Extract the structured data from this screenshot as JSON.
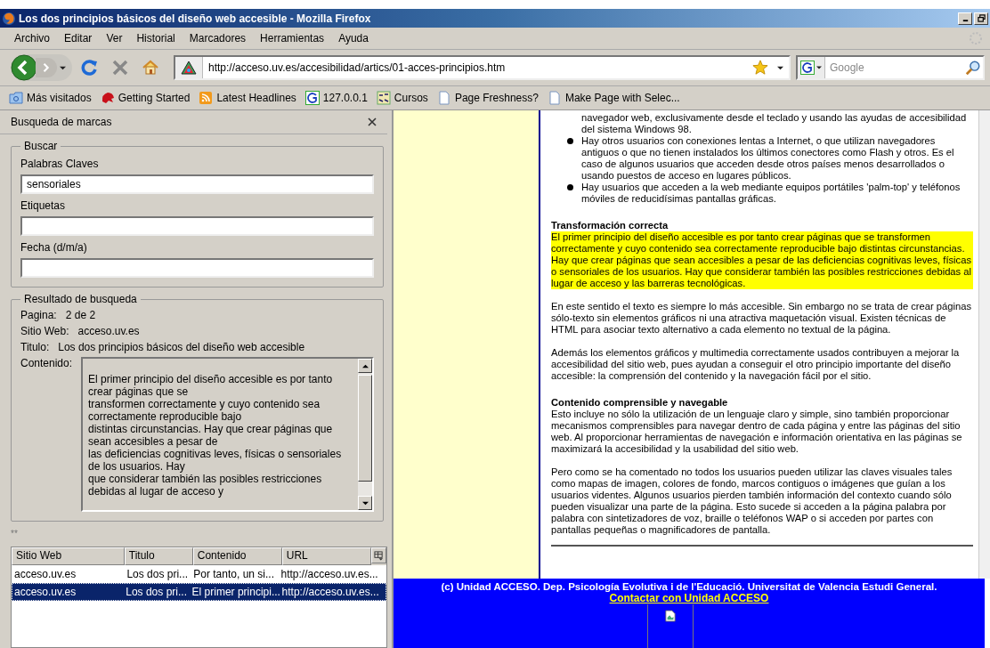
{
  "window": {
    "title": "Los dos principios básicos del diseño web accesible - Mozilla Firefox"
  },
  "menu": [
    {
      "label": "Archivo"
    },
    {
      "label": "Editar"
    },
    {
      "label": "Ver"
    },
    {
      "label": "Historial"
    },
    {
      "label": "Marcadores"
    },
    {
      "label": "Herramientas"
    },
    {
      "label": "Ayuda"
    }
  ],
  "toolbar": {
    "url": "http://acceso.uv.es/accesibilidad/artics/01-acces-principios.htm",
    "search_placeholder": "Google"
  },
  "bookmarks": [
    {
      "label": "Más visitados",
      "kind": "folder"
    },
    {
      "label": "Getting Started",
      "kind": "creature"
    },
    {
      "label": "Latest Headlines",
      "kind": "feed"
    },
    {
      "label": "127.0.0.1",
      "kind": "letter"
    },
    {
      "label": "Cursos",
      "kind": "badge"
    },
    {
      "label": "Page Freshness?",
      "kind": "page"
    },
    {
      "label": "Make Page with Selec...",
      "kind": "page"
    }
  ],
  "sidebar": {
    "title": "Busqueda de marcas",
    "search_group": {
      "legend": "Buscar",
      "fields": [
        {
          "label": "Palabras Claves",
          "value": "sensoriales"
        },
        {
          "label": "Etiquetas"
        },
        {
          "label": "Fecha (d/m/a)"
        }
      ]
    },
    "result_group": {
      "legend": "Resultado de busqueda",
      "details": [
        {
          "label": "Pagina:",
          "value": "2 de 2"
        },
        {
          "label": "Sitio Web:",
          "value": "acceso.uv.es"
        },
        {
          "label": "Titulo:",
          "value": "Los dos principios básicos del diseño web accesible"
        }
      ],
      "content_label": "Contenido:",
      "content_lines": [
        "El primer principio del diseño accesible es por tanto crear páginas que se",
        "transformen correctamente y cuyo contenido sea correctamente reproducible bajo",
        "distintas circunstancias. Hay que crear páginas que sean accesibles a pesar de",
        "las deficiencias cognitivas leves, físicas o sensoriales de los usuarios. Hay",
        "que considerar también las posibles restricciones debidas al lugar de acceso y"
      ]
    },
    "separator_text": "**",
    "table": {
      "columns": [
        "Sitio Web",
        "Titulo",
        "Contenido",
        "URL"
      ],
      "rows": [
        {
          "cells": [
            "acceso.uv.es",
            "Los dos pri...",
            "Por tanto, un si...",
            "http://acceso.uv.es..."
          ],
          "selected": false
        },
        {
          "cells": [
            "acceso.uv.es",
            "Los dos pri...",
            "El primer principi...",
            "http://acceso.uv.es..."
          ],
          "selected": true
        }
      ]
    }
  },
  "page": {
    "list": [
      {
        "kind": "continuation",
        "text": "navegador web, exclusivamente desde el teclado y usando las ayudas de accesibilidad del sistema Windows 98."
      },
      {
        "kind": "bullet",
        "text": "Hay otros usuarios con conexiones lentas a Internet, o que utilizan navegadores antiguos o que no tienen instalados los últimos conectores como Flash y otros. Es el caso de algunos usuarios que acceden desde otros países menos desarrollados o usando puestos de acceso en lugares públicos."
      },
      {
        "kind": "bullet",
        "text": "Hay usuarios que acceden a la web mediante equipos portátiles 'palm-top' y teléfonos móviles de reducidísimas pantallas gráficas."
      }
    ],
    "sections": [
      {
        "heading": "Transformación correcta",
        "paragraphs": [
          {
            "text": "El primer principio del diseño accesible es por tanto crear páginas que se transformen correctamente y cuyo contenido sea correctamente reproducible bajo distintas circunstancias. Hay que crear páginas que sean accesibles a pesar de las deficiencias cognitivas leves, físicas o sensoriales de los usuarios. Hay que considerar también las posibles restricciones debidas al lugar de acceso y las barreras tecnológicas.",
            "highlighted": true
          },
          {
            "text": "En este sentido el texto es siempre lo más accesible. Sin embargo no se trata de crear páginas sólo-texto sin elementos gráficos ni una atractiva maquetación visual. Existen técnicas de HTML para asociar texto alternativo a cada elemento no textual de la página.",
            "highlighted": false
          },
          {
            "text": "Además los elementos gráficos y multimedia correctamente usados contribuyen a mejorar la accesibilidad del sitio web, pues ayudan a conseguir el otro principio importante del diseño accesible: la comprensión del contenido y la navegación fácil por el sitio.",
            "highlighted": false
          }
        ]
      },
      {
        "heading": "Contenido comprensible y navegable",
        "paragraphs": [
          {
            "text": "Esto incluye no sólo la utilización de un lenguaje claro y simple, sino también proporcionar mecanismos comprensibles para navegar dentro de cada página y entre las páginas del sitio web. Al proporcionar herramientas de navegación e información orientativa en las páginas se maximizará la accesibilidad y la usabilidad del sitio web.",
            "highlighted": false
          },
          {
            "text": "Pero como se ha comentado no todos los usuarios pueden utilizar las claves visuales tales como mapas de imagen, colores de fondo, marcos contiguos o imágenes que guían a los usuarios videntes. Algunos usuarios pierden también información del contexto cuando sólo pueden visualizar una parte de la página. Esto sucede si acceden a la página palabra por palabra con sintetizadores de voz, braille o teléfonos WAP o si acceden por partes con pantallas pequeñas o magnificadores de pantalla.",
            "highlighted": false
          }
        ]
      }
    ],
    "footer": {
      "copyright": "(c) Unidad ACCESO. Dep. Psicología Evolutiva i de l'Educació. Universitat de Valencia Estudi General.",
      "link": "Contactar con Unidad ACCESO"
    }
  }
}
